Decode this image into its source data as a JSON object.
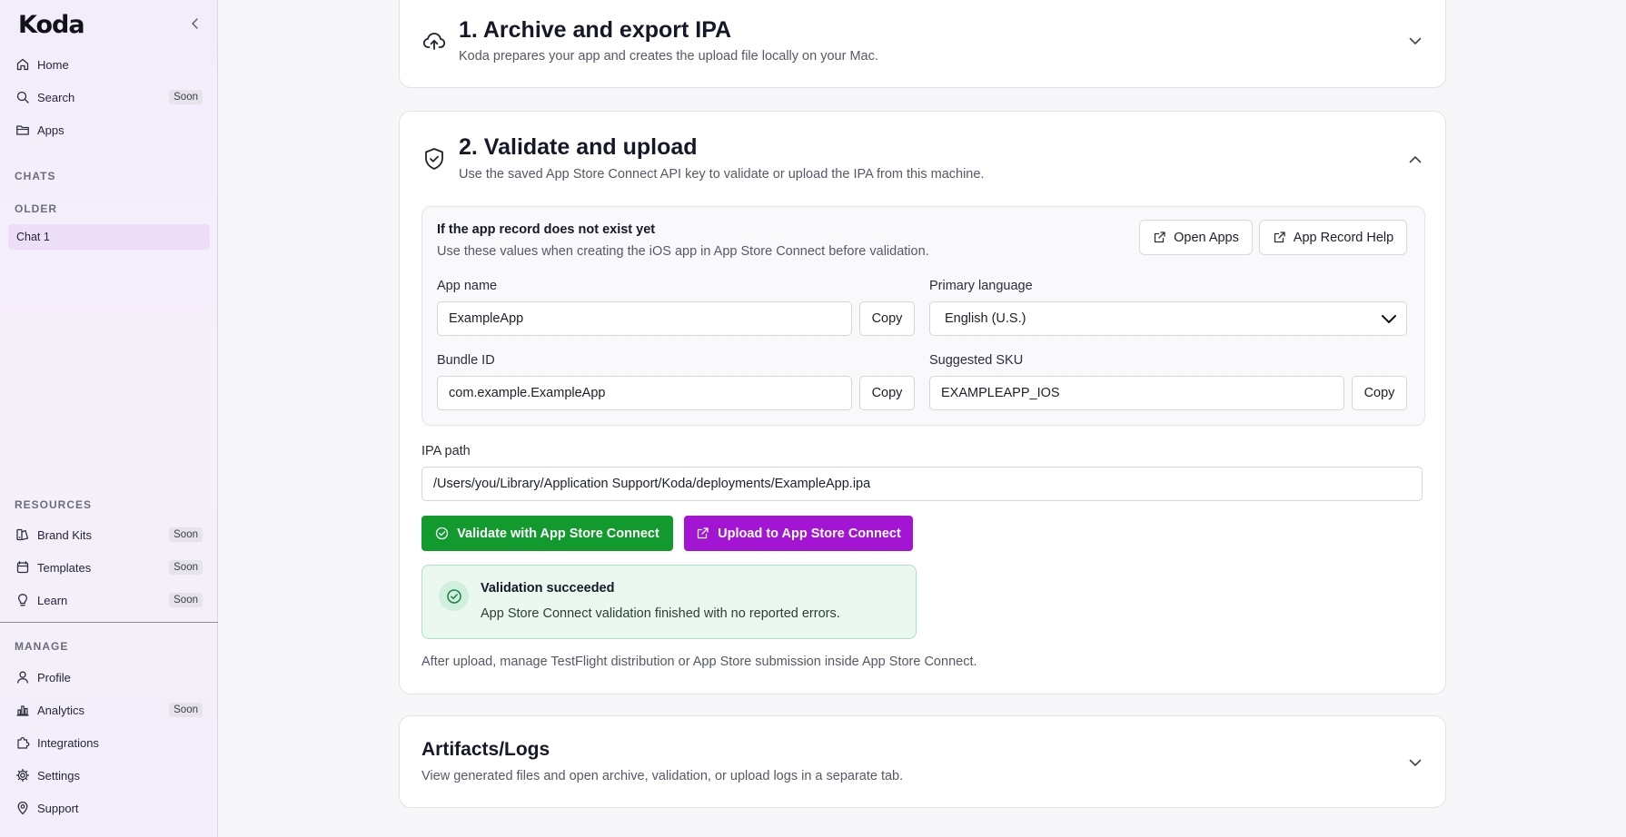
{
  "sidebar": {
    "logo": "Koda",
    "nav": [
      {
        "label": "Home",
        "badge": ""
      },
      {
        "label": "Search",
        "badge": "Soon"
      },
      {
        "label": "Apps",
        "badge": ""
      }
    ],
    "chats_title": "CHATS",
    "older_title": "OLDER",
    "chat_item": "Chat 1",
    "resources_title": "RESOURCES",
    "resources": [
      {
        "label": "Brand Kits",
        "badge": "Soon"
      },
      {
        "label": "Templates",
        "badge": "Soon"
      },
      {
        "label": "Learn",
        "badge": "Soon"
      }
    ],
    "manage_title": "MANAGE",
    "manage": [
      {
        "label": "Profile",
        "badge": ""
      },
      {
        "label": "Analytics",
        "badge": "Soon"
      },
      {
        "label": "Integrations",
        "badge": ""
      },
      {
        "label": "Settings",
        "badge": ""
      },
      {
        "label": "Support",
        "badge": ""
      }
    ]
  },
  "step1": {
    "title": "1. Archive and export IPA",
    "subtitle": "Koda prepares your app and creates the upload file locally on your Mac."
  },
  "step2": {
    "title": "2. Validate and upload",
    "subtitle": "Use the saved App Store Connect API key to validate or upload the IPA from this machine.",
    "record": {
      "heading": "If the app record does not exist yet",
      "description": "Use these values when creating the iOS app in App Store Connect before validation.",
      "open_apps": "Open Apps",
      "record_help": "App Record Help",
      "app_name_label": "App name",
      "app_name_value": "ExampleApp",
      "primary_language_label": "Primary language",
      "primary_language_value": "English (U.S.)",
      "bundle_id_label": "Bundle ID",
      "bundle_id_value": "com.example.ExampleApp",
      "sku_label": "Suggested SKU",
      "sku_value": "EXAMPLEAPP_IOS",
      "copy": "Copy"
    },
    "ipa_path_label": "IPA path",
    "ipa_path_value": "/Users/you/Library/Application Support/Koda/deployments/ExampleApp.ipa",
    "validate_button": "Validate with App Store Connect",
    "upload_button": "Upload to App Store Connect",
    "success_title": "Validation succeeded",
    "success_message": "App Store Connect validation finished with no reported errors.",
    "footer_note": "After upload, manage TestFlight distribution or App Store submission inside App Store Connect."
  },
  "artifacts": {
    "title": "Artifacts/Logs",
    "subtitle": "View generated files and open archive, validation, or upload logs in a separate tab."
  },
  "colors": {
    "validate": "#139a2e",
    "upload": "#a414d3",
    "success_bg": "#eaf8ef",
    "success_border": "#a9e3c0",
    "success_icon": "#19804a"
  }
}
